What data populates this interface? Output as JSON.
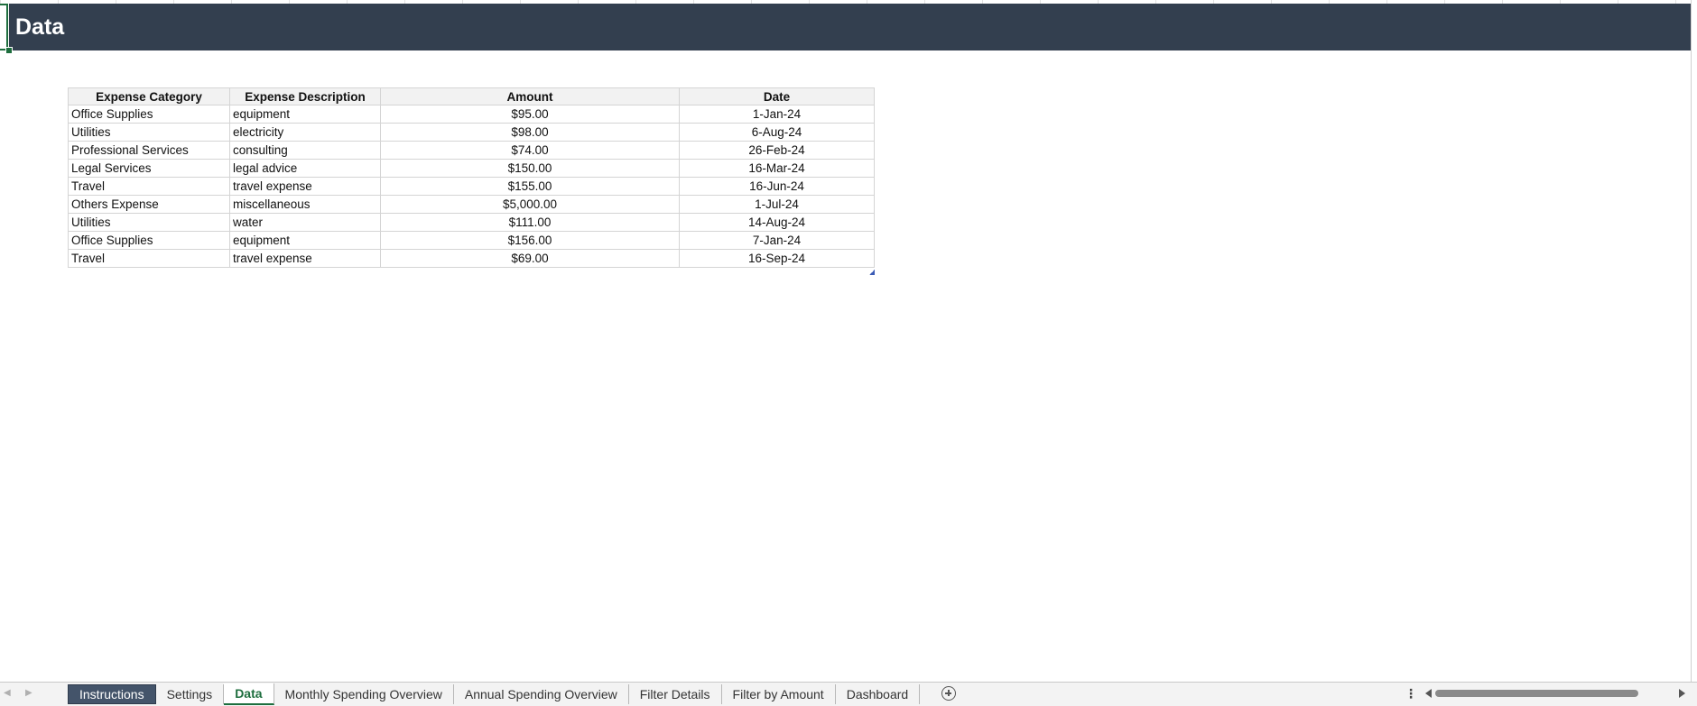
{
  "banner": {
    "title": "Data"
  },
  "table": {
    "headers": [
      "Expense Category",
      "Expense Description",
      "Amount",
      "Date"
    ],
    "rows": [
      {
        "category": "Office Supplies",
        "description": "equipment",
        "amount": "$95.00",
        "date": "1-Jan-24"
      },
      {
        "category": "Utilities",
        "description": "electricity",
        "amount": "$98.00",
        "date": "6-Aug-24"
      },
      {
        "category": "Professional Services",
        "description": "consulting",
        "amount": "$74.00",
        "date": "26-Feb-24"
      },
      {
        "category": "Legal Services",
        "description": "legal advice",
        "amount": "$150.00",
        "date": "16-Mar-24"
      },
      {
        "category": "Travel",
        "description": "travel expense",
        "amount": "$155.00",
        "date": "16-Jun-24"
      },
      {
        "category": "Others Expense",
        "description": "miscellaneous",
        "amount": "$5,000.00",
        "date": "1-Jul-24"
      },
      {
        "category": "Utilities",
        "description": "water",
        "amount": "$111.00",
        "date": "14-Aug-24"
      },
      {
        "category": "Office Supplies",
        "description": "equipment",
        "amount": "$156.00",
        "date": "7-Jan-24"
      },
      {
        "category": "Travel",
        "description": "travel expense",
        "amount": "$69.00",
        "date": "16-Sep-24"
      }
    ]
  },
  "sheet_tabs": [
    {
      "label": "Instructions",
      "state": "colored"
    },
    {
      "label": "Settings",
      "state": "normal"
    },
    {
      "label": "Data",
      "state": "active"
    },
    {
      "label": "Monthly Spending Overview",
      "state": "normal"
    },
    {
      "label": "Annual Spending Overview",
      "state": "normal"
    },
    {
      "label": "Filter Details",
      "state": "normal"
    },
    {
      "label": "Filter by Amount",
      "state": "normal"
    },
    {
      "label": "Dashboard",
      "state": "normal"
    }
  ],
  "icons": {
    "prev_sheet": "chevron-left-icon",
    "next_sheet": "chevron-right-icon",
    "add_sheet": "plus-circle-icon",
    "more": "more-vertical-icon"
  },
  "colors": {
    "banner": "#333f4f",
    "active_tab": "#1e6e3e",
    "colored_tab": "#44546a"
  }
}
